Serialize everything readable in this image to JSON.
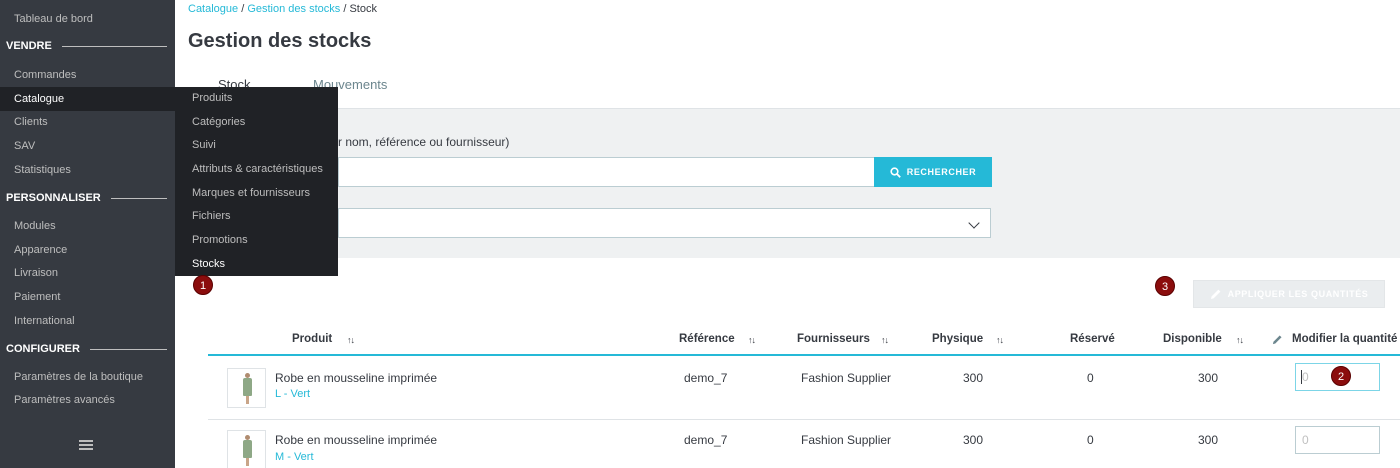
{
  "sidebar": {
    "items": [
      {
        "type": "item",
        "label": "Tableau de bord"
      },
      {
        "type": "section",
        "label": "VENDRE"
      },
      {
        "type": "item",
        "label": "Commandes"
      },
      {
        "type": "item",
        "label": "Catalogue",
        "active": true
      },
      {
        "type": "item",
        "label": "Clients"
      },
      {
        "type": "item",
        "label": "SAV"
      },
      {
        "type": "item",
        "label": "Statistiques"
      },
      {
        "type": "section",
        "label": "PERSONNALISER"
      },
      {
        "type": "item",
        "label": "Modules"
      },
      {
        "type": "item",
        "label": "Apparence"
      },
      {
        "type": "item",
        "label": "Livraison"
      },
      {
        "type": "item",
        "label": "Paiement"
      },
      {
        "type": "item",
        "label": "International"
      },
      {
        "type": "section",
        "label": "CONFIGURER"
      },
      {
        "type": "item",
        "label": "Paramètres de la boutique"
      },
      {
        "type": "item",
        "label": "Paramètres avancés"
      }
    ],
    "menu_icon": "hamburger-icon"
  },
  "flyout": {
    "items": [
      "Produits",
      "Catégories",
      "Suivi",
      "Attributs & caractéristiques",
      "Marques et fournisseurs",
      "Fichiers",
      "Promotions",
      "Stocks"
    ],
    "active": "Stocks"
  },
  "header": {
    "breadcrumb": [
      "Catalogue",
      "Gestion des stocks",
      "Stock"
    ],
    "breadcrumb_sep": " / ",
    "title": "Gestion des stocks",
    "tabs": [
      "Stock",
      "Mouvements"
    ]
  },
  "filters": {
    "search_label_visible": "r nom, référence ou fournisseur)",
    "search_button": "RECHERCHER",
    "search_icon": "search-icon",
    "select_icon": "chevron-down-icon"
  },
  "badges": [
    "1",
    "2",
    "3"
  ],
  "apply_button": {
    "label": "APPLIQUER LES QUANTITÉS",
    "icon": "pencil-icon"
  },
  "table": {
    "columns": [
      "Produit",
      "Référence",
      "Fournisseurs",
      "Physique",
      "Réservé",
      "Disponible",
      "Modifier la quantité"
    ],
    "sort_icon": "sort-icon",
    "rows": [
      {
        "name": "Robe en mousseline imprimée",
        "variant": "L - Vert",
        "reference": "demo_7",
        "supplier": "Fashion Supplier",
        "physical": "300",
        "reserved": "0",
        "available": "300",
        "qty_placeholder": "0"
      },
      {
        "name": "Robe en mousseline imprimée",
        "variant": "M - Vert",
        "reference": "demo_7",
        "supplier": "Fashion Supplier",
        "physical": "300",
        "reserved": "0",
        "available": "300",
        "qty_placeholder": "0"
      }
    ]
  },
  "colors": {
    "accent": "#25b9d7",
    "sidebar": "#363a41",
    "badge": "#8b0d0d"
  }
}
